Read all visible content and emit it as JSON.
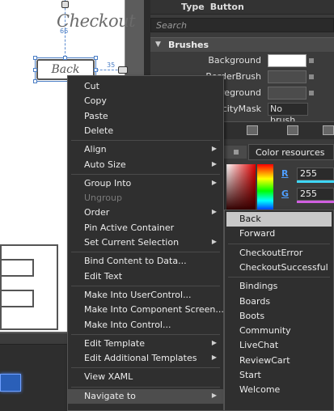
{
  "canvas": {
    "title": "Checkout",
    "button_label": "Back",
    "dim_top": "66",
    "dim_right": "35"
  },
  "panel": {
    "type_label": "Type",
    "type_value": "Button",
    "search_placeholder": "Search",
    "section_title": "Brushes",
    "properties": [
      {
        "label": "Background",
        "kind": "swatch",
        "color": "#ffffff"
      },
      {
        "label": "BorderBrush",
        "kind": "swatch",
        "color": "#4c4c4c"
      },
      {
        "label": "Foreground",
        "kind": "swatch",
        "color": "#4c4c4c"
      },
      {
        "label": "OpacityMask",
        "kind": "text",
        "value": "No brush"
      }
    ],
    "color_resources_label": "Color resources",
    "channels": [
      {
        "label": "R",
        "value": "255",
        "bar_color": "#3fd6f6"
      },
      {
        "label": "G",
        "value": "255",
        "bar_color": "#d05fe0"
      }
    ]
  },
  "context_menu": {
    "groups": [
      [
        {
          "label": "Cut"
        },
        {
          "label": "Copy"
        },
        {
          "label": "Paste"
        },
        {
          "label": "Delete"
        }
      ],
      [
        {
          "label": "Align",
          "submenu": true
        },
        {
          "label": "Auto Size",
          "submenu": true
        }
      ],
      [
        {
          "label": "Group Into",
          "submenu": true
        },
        {
          "label": "Ungroup",
          "disabled": true
        },
        {
          "label": "Order",
          "submenu": true
        },
        {
          "label": "Pin Active Container"
        },
        {
          "label": "Set Current Selection",
          "submenu": true
        }
      ],
      [
        {
          "label": "Bind Content to Data..."
        },
        {
          "label": "Edit Text"
        }
      ],
      [
        {
          "label": "Make Into UserControl..."
        },
        {
          "label": "Make Into Component Screen..."
        },
        {
          "label": "Make Into Control..."
        }
      ],
      [
        {
          "label": "Edit Template",
          "submenu": true
        },
        {
          "label": "Edit Additional Templates",
          "submenu": true
        }
      ],
      [
        {
          "label": "View XAML"
        }
      ],
      [
        {
          "label": "Navigate to",
          "submenu": true,
          "active": true
        }
      ]
    ]
  },
  "navigate_submenu": {
    "groups": [
      [
        {
          "label": "Back",
          "highlighted": true
        },
        {
          "label": "Forward"
        }
      ],
      [
        {
          "label": "CheckoutError"
        },
        {
          "label": "CheckoutSuccessful"
        }
      ],
      [
        {
          "label": "Bindings"
        },
        {
          "label": "Boards"
        },
        {
          "label": "Boots"
        },
        {
          "label": "Community"
        },
        {
          "label": "LiveChat"
        },
        {
          "label": "ReviewCart"
        },
        {
          "label": "Start"
        },
        {
          "label": "Welcome"
        }
      ]
    ]
  }
}
